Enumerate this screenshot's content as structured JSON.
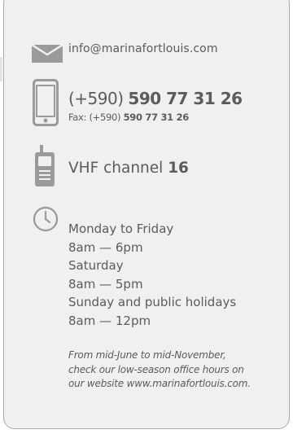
{
  "contact": {
    "icons": {
      "email": "envelope-icon",
      "phone": "mobile-phone-icon",
      "vhf": "walkie-talkie-icon",
      "hours": "clock-icon"
    },
    "email": "info@marinafortlouis.com",
    "phone": {
      "prefix": "(+590)",
      "number": "590 77 31 26"
    },
    "fax": {
      "label_prefix": "Fax: (+590)",
      "number": "590 77 31 26"
    },
    "vhf": {
      "label": "VHF channel",
      "channel": "16"
    },
    "hours": [
      "Monday to Friday",
      "8am — 6pm",
      "Saturday",
      "8am — 5pm",
      "Sunday and public holidays",
      "8am — 12pm"
    ],
    "note_lines": [
      "From mid-June to mid-November,",
      "check our low-season office hours on",
      "our website www.marinafortlouis.com."
    ]
  },
  "colors": {
    "card_background": "#f0f0f0",
    "card_border": "#a9a9a9",
    "text": "#5b5b5b",
    "icon": "#9a9a9a"
  }
}
